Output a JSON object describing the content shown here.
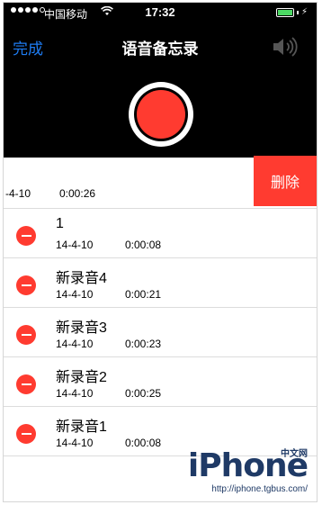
{
  "status_bar": {
    "carrier": "中国移动",
    "time": "17:32",
    "wifi_icon": "wifi-icon",
    "battery_icon": "battery-icon"
  },
  "nav": {
    "done_label": "完成",
    "title": "语音备忘录",
    "speaker_icon": "speaker-icon"
  },
  "record_button": {
    "icon": "record-icon",
    "color": "#ff3b30"
  },
  "swiped_row": {
    "date": "-4-10",
    "duration": "0:00:26",
    "delete_label": "删除"
  },
  "recordings": [
    {
      "name": "1",
      "date": "14-4-10",
      "duration": "0:00:08"
    },
    {
      "name": "新录音4",
      "date": "14-4-10",
      "duration": "0:00:21"
    },
    {
      "name": "新录音3",
      "date": "14-4-10",
      "duration": "0:00:23"
    },
    {
      "name": "新录音2",
      "date": "14-4-10",
      "duration": "0:00:25"
    },
    {
      "name": "新录音1",
      "date": "14-4-10",
      "duration": "0:00:08"
    }
  ],
  "watermark": {
    "logo": "iPhone",
    "tag": "中文网",
    "url": "http://iphone.tgbus.com/"
  },
  "colors": {
    "accent": "#1e7cf2",
    "destructive": "#ff3b30",
    "battery": "#4cd964"
  }
}
